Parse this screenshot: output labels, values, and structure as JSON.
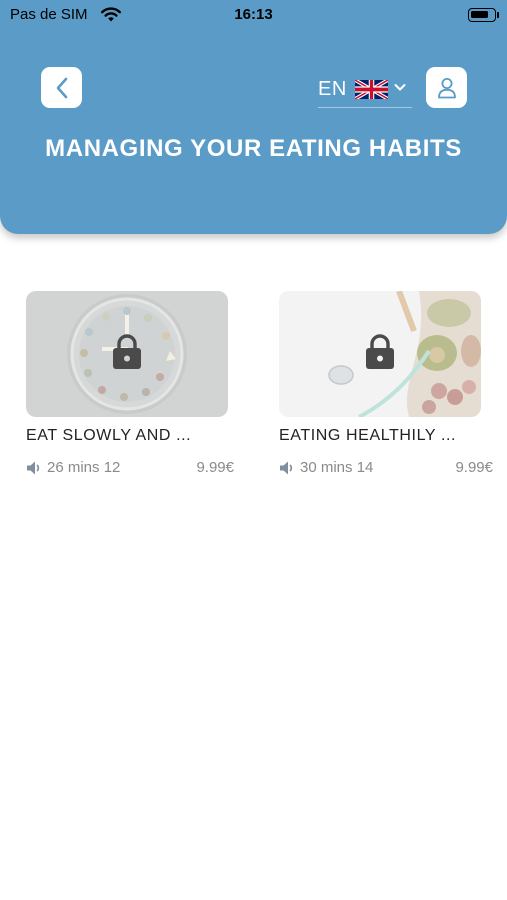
{
  "status_bar": {
    "carrier": "Pas de SIM",
    "time": "16:13"
  },
  "header": {
    "title": "MANAGING YOUR EATING HABITS",
    "language": {
      "code": "EN",
      "flag_icon": "uk-flag-icon"
    },
    "back_icon": "chevron-left-icon",
    "profile_icon": "user-icon",
    "background_color": "#5a9cc7"
  },
  "cards": [
    {
      "title": "EAT SLOWLY AND ...",
      "duration": "26 mins 12",
      "price": "9.99€",
      "locked": true,
      "image": "plate-clock-image"
    },
    {
      "title": "EATING HEALTHILY ...",
      "duration": "30 mins 14",
      "price": "9.99€",
      "locked": true,
      "image": "healthy-food-image"
    }
  ]
}
